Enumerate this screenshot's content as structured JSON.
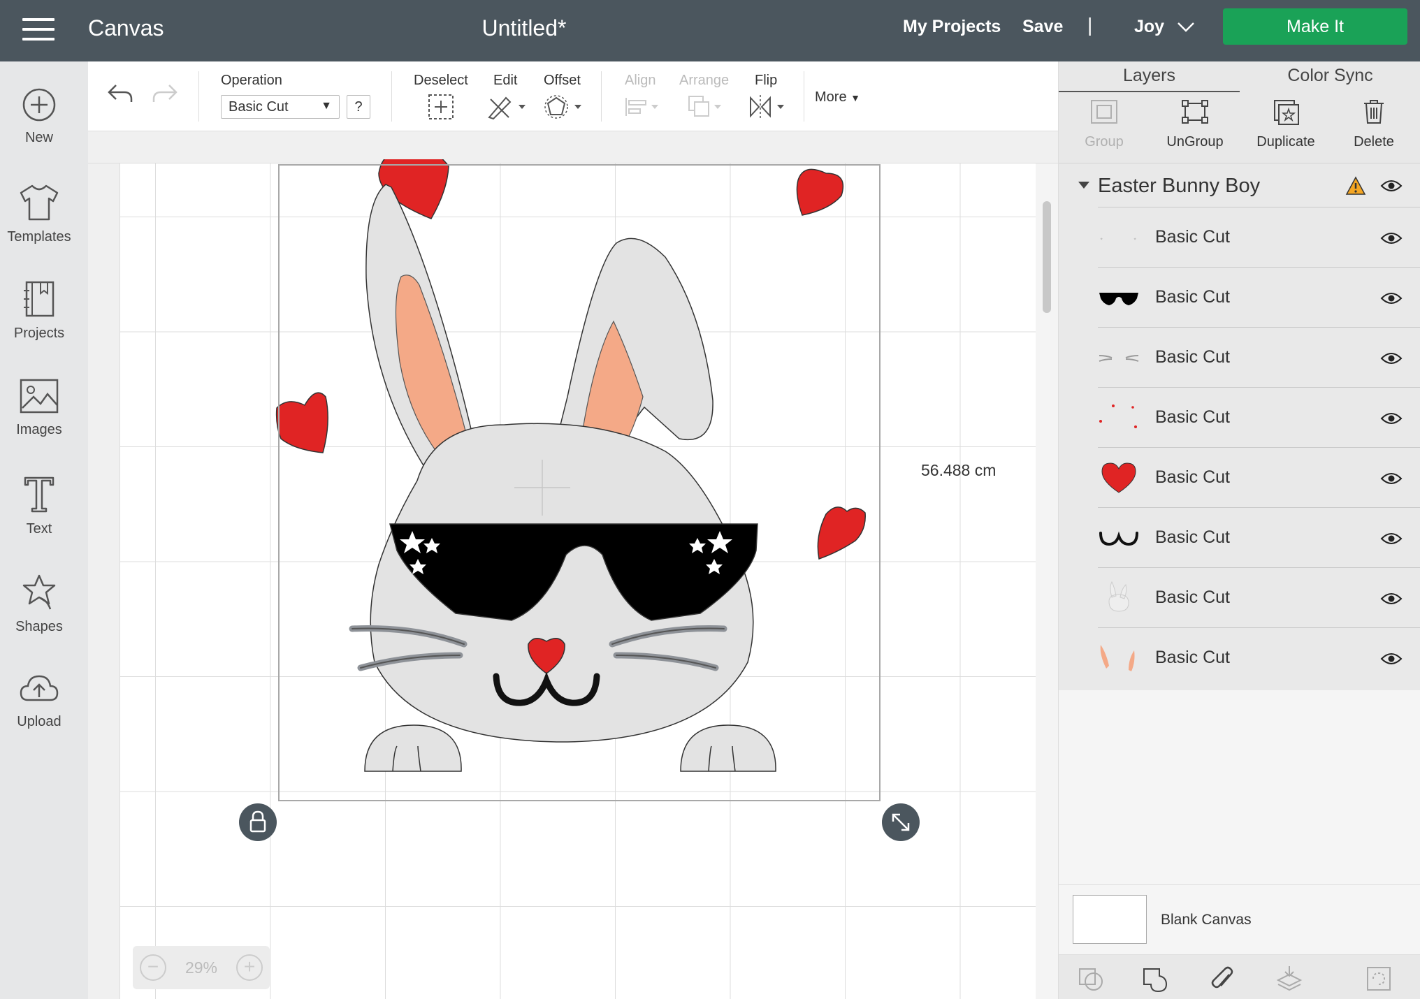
{
  "topbar": {
    "app_title": "Canvas",
    "doc_title": "Untitled*",
    "my_projects": "My Projects",
    "save": "Save",
    "separator": "|",
    "user": "Joy",
    "make_it": "Make It"
  },
  "sidebar": {
    "items": [
      {
        "label": "New",
        "icon": "plus-circle-icon"
      },
      {
        "label": "Templates",
        "icon": "tshirt-icon"
      },
      {
        "label": "Projects",
        "icon": "notebook-icon"
      },
      {
        "label": "Images",
        "icon": "image-icon"
      },
      {
        "label": "Text",
        "icon": "text-icon"
      },
      {
        "label": "Shapes",
        "icon": "shapes-icon"
      },
      {
        "label": "Upload",
        "icon": "cloud-upload-icon"
      }
    ]
  },
  "toolbar": {
    "operation_label": "Operation",
    "operation_value": "Basic Cut",
    "help": "?",
    "deselect": "Deselect",
    "edit": "Edit",
    "offset": "Offset",
    "align": "Align",
    "arrange": "Arrange",
    "flip": "Flip",
    "more": "More"
  },
  "canvas": {
    "dimension": "56.488 cm",
    "zoom": "29%",
    "zoom_minus": "−",
    "zoom_plus": "+"
  },
  "panel": {
    "tabs": [
      "Layers",
      "Color Sync"
    ],
    "actions": [
      {
        "label": "Group",
        "enabled": false
      },
      {
        "label": "UnGroup",
        "enabled": true
      },
      {
        "label": "Duplicate",
        "enabled": true
      },
      {
        "label": "Delete",
        "enabled": true
      }
    ],
    "group_name": "Easter Bunny Boy",
    "layers": [
      {
        "name": "Basic Cut",
        "thumb": "stars"
      },
      {
        "name": "Basic Cut",
        "thumb": "sunglasses"
      },
      {
        "name": "Basic Cut",
        "thumb": "whiskers"
      },
      {
        "name": "Basic Cut",
        "thumb": "small-hearts"
      },
      {
        "name": "Basic Cut",
        "thumb": "heart"
      },
      {
        "name": "Basic Cut",
        "thumb": "mouth"
      },
      {
        "name": "Basic Cut",
        "thumb": "bunny"
      },
      {
        "name": "Basic Cut",
        "thumb": "ears"
      }
    ],
    "blank_canvas": "Blank Canvas"
  },
  "colors": {
    "topbar": "#4b565e",
    "make_it": "#1aa257",
    "heart": "#e02424",
    "ear_inner": "#f4a987",
    "bunny_fill": "#e3e3e3"
  }
}
